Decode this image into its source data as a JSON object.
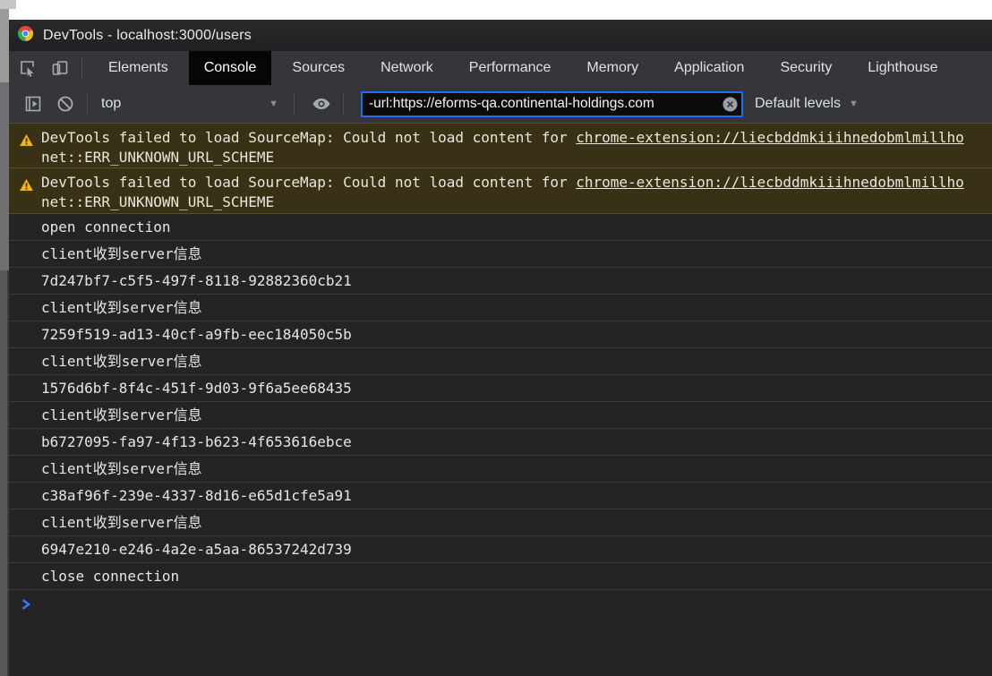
{
  "window": {
    "title": "DevTools - localhost:3000/users"
  },
  "tabs": {
    "items": [
      {
        "id": "elements",
        "label": "Elements",
        "selected": false
      },
      {
        "id": "console",
        "label": "Console",
        "selected": true
      },
      {
        "id": "sources",
        "label": "Sources",
        "selected": false
      },
      {
        "id": "network",
        "label": "Network",
        "selected": false
      },
      {
        "id": "performance",
        "label": "Performance",
        "selected": false
      },
      {
        "id": "memory",
        "label": "Memory",
        "selected": false
      },
      {
        "id": "application",
        "label": "Application",
        "selected": false
      },
      {
        "id": "security",
        "label": "Security",
        "selected": false
      },
      {
        "id": "lighthouse",
        "label": "Lighthouse",
        "selected": false
      }
    ]
  },
  "toolbar": {
    "context_selector": "top",
    "filter_value": "-url:https://eforms-qa.continental-holdings.com",
    "levels_label": "Default levels",
    "dropdown_arrow": "▼"
  },
  "console": {
    "warnings": [
      {
        "text": "DevTools failed to load SourceMap: Could not load content for ",
        "link": "chrome-extension://liecbddmkiiihnedobmlmillho",
        "line2": "net::ERR_UNKNOWN_URL_SCHEME"
      },
      {
        "text": "DevTools failed to load SourceMap: Could not load content for ",
        "link": "chrome-extension://liecbddmkiiihnedobmlmillho",
        "line2": "net::ERR_UNKNOWN_URL_SCHEME"
      }
    ],
    "messages": [
      "open connection",
      "client收到server信息",
      "7d247bf7-c5f5-497f-8118-92882360cb21",
      "client收到server信息",
      "7259f519-ad13-40cf-a9fb-eec184050c5b",
      "client收到server信息",
      "1576d6bf-8f4c-451f-9d03-9f6a5ee68435",
      "client收到server信息",
      "b6727095-fa97-4f13-b623-4f653616ebce",
      "client收到server信息",
      "c38af96f-239e-4337-8d16-e65d1cfe5a91",
      "client收到server信息",
      "6947e210-e246-4a2e-a5aa-86537242d739",
      "close connection"
    ]
  },
  "icons": {
    "chrome": "chrome-logo",
    "inspect": "cursor-in-square",
    "device_toolbar": "phone-and-tablet",
    "console_sidebar": "panel-with-play",
    "clear_console": "slashed-circle",
    "live_expression": "eye",
    "clear_filter": "circle-x",
    "warning": "triangle-exclamation",
    "prompt": "chevron-right"
  },
  "colors": {
    "accent_blue": "#1f6ff2",
    "prompt_blue": "#3178f6",
    "warning_bg": "#393116",
    "warning_icon": "#f2b41a",
    "console_bg": "#242424",
    "toolbar_bg": "#35363a",
    "titlebar_bg": "#232326",
    "icon_gray": "#9aa0a6"
  }
}
